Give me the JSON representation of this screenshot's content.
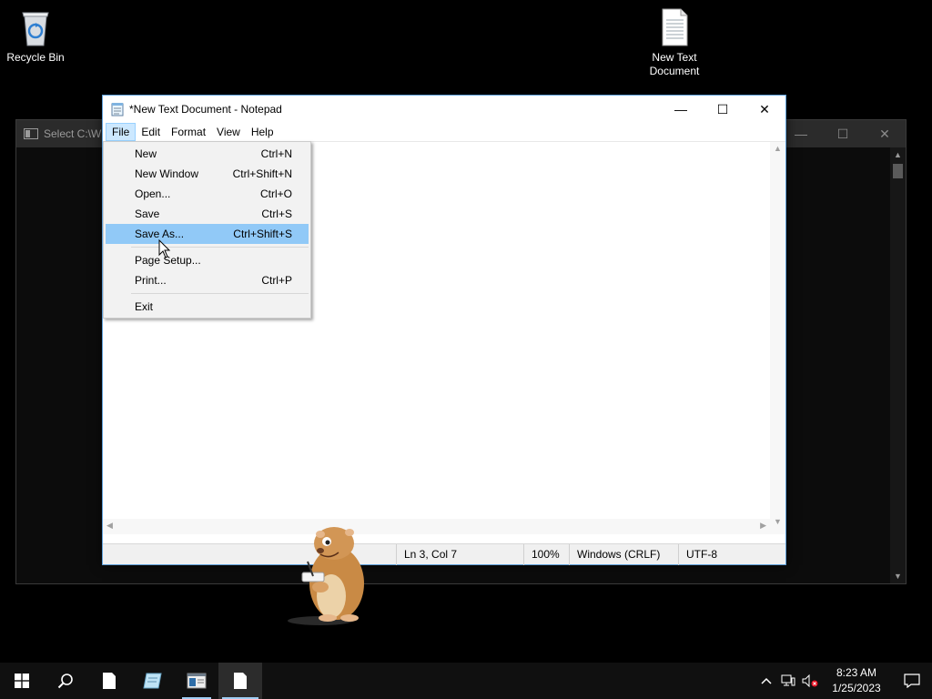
{
  "desktop": {
    "icons": [
      {
        "label": "Recycle Bin"
      },
      {
        "label": "New Text Document"
      }
    ]
  },
  "console_window": {
    "title": "Select C:\\Wi"
  },
  "notepad": {
    "title": "*New Text Document - Notepad",
    "menus": [
      "File",
      "Edit",
      "Format",
      "View",
      "Help"
    ],
    "file_menu": [
      {
        "label": "New",
        "shortcut": "Ctrl+N"
      },
      {
        "label": "New Window",
        "shortcut": "Ctrl+Shift+N"
      },
      {
        "label": "Open...",
        "shortcut": "Ctrl+O"
      },
      {
        "label": "Save",
        "shortcut": "Ctrl+S"
      },
      {
        "label": "Save As...",
        "shortcut": "Ctrl+Shift+S"
      },
      {
        "label": "Page Setup...",
        "shortcut": ""
      },
      {
        "label": "Print...",
        "shortcut": "Ctrl+P"
      },
      {
        "label": "Exit",
        "shortcut": ""
      }
    ],
    "status": {
      "position": "Ln 3, Col 7",
      "zoom": "100%",
      "line_ending": "Windows (CRLF)",
      "encoding": "UTF-8"
    }
  },
  "taskbar": {
    "time": "8:23 AM",
    "date": "1/25/2023"
  },
  "colors": {
    "menu_highlight": "#91c9f7",
    "menu_open": "#cce8ff",
    "taskbar": "#101010",
    "accent": "#9fcdf3"
  }
}
